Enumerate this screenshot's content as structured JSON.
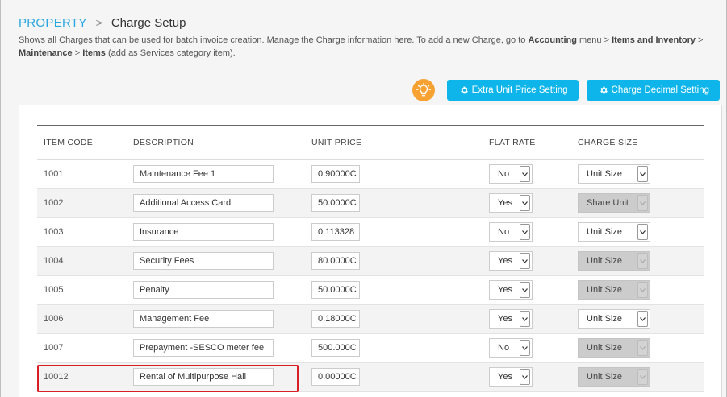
{
  "breadcrumb": {
    "root": "PROPERTY",
    "separator": ">",
    "page": "Charge Setup"
  },
  "description": {
    "text1": "Shows all Charges that can be used for batch invoice creation. Manage the Charge information here. To add a new Charge, go to ",
    "bold1": "Accounting",
    "text2": " menu > ",
    "bold2": "Items and Inventory",
    "text3": " > ",
    "bold3": "Maintenance",
    "text4": " > ",
    "bold4": "Items",
    "text5": " (add as Services category item)."
  },
  "toolbar": {
    "tip_icon": "lightbulb-icon",
    "extra_unit_price_label": "Extra Unit Price Setting",
    "charge_decimal_label": "Charge Decimal Setting"
  },
  "table": {
    "headers": {
      "item_code": "ITEM CODE",
      "description": "DESCRIPTION",
      "unit_price": "UNIT PRICE",
      "flat_rate": "FLAT RATE",
      "charge_size": "CHARGE SIZE"
    },
    "rows": [
      {
        "code": "1001",
        "description": "Maintenance Fee 1",
        "unit_price": "0.90000C",
        "flat_rate": "No",
        "charge_size": "Unit Size",
        "size_disabled": false
      },
      {
        "code": "1002",
        "description": "Additional Access Card",
        "unit_price": "50.0000C",
        "flat_rate": "Yes",
        "charge_size": "Share Unit",
        "size_disabled": true
      },
      {
        "code": "1003",
        "description": "Insurance",
        "unit_price": "0.113328",
        "flat_rate": "No",
        "charge_size": "Unit Size",
        "size_disabled": false
      },
      {
        "code": "1004",
        "description": "Security Fees",
        "unit_price": "80.0000C",
        "flat_rate": "Yes",
        "charge_size": "Unit Size",
        "size_disabled": true
      },
      {
        "code": "1005",
        "description": "Penalty",
        "unit_price": "50.0000C",
        "flat_rate": "Yes",
        "charge_size": "Unit Size",
        "size_disabled": true
      },
      {
        "code": "1006",
        "description": "Management Fee",
        "unit_price": "0.18000C",
        "flat_rate": "Yes",
        "charge_size": "Unit Size",
        "size_disabled": false
      },
      {
        "code": "1007",
        "description": "Prepayment -SESCO meter fee",
        "unit_price": "500.000C",
        "flat_rate": "No",
        "charge_size": "Unit Size",
        "size_disabled": true
      },
      {
        "code": "10012",
        "description": "Rental of Multipurpose Hall",
        "unit_price": "0.00000C",
        "flat_rate": "Yes",
        "charge_size": "Unit Size",
        "size_disabled": true
      }
    ]
  },
  "colors": {
    "accent": "#0eb5ea",
    "breadcrumb_root": "#29a7de",
    "tip_icon_bg": "#f7a233",
    "highlight_border": "#d81f26"
  }
}
